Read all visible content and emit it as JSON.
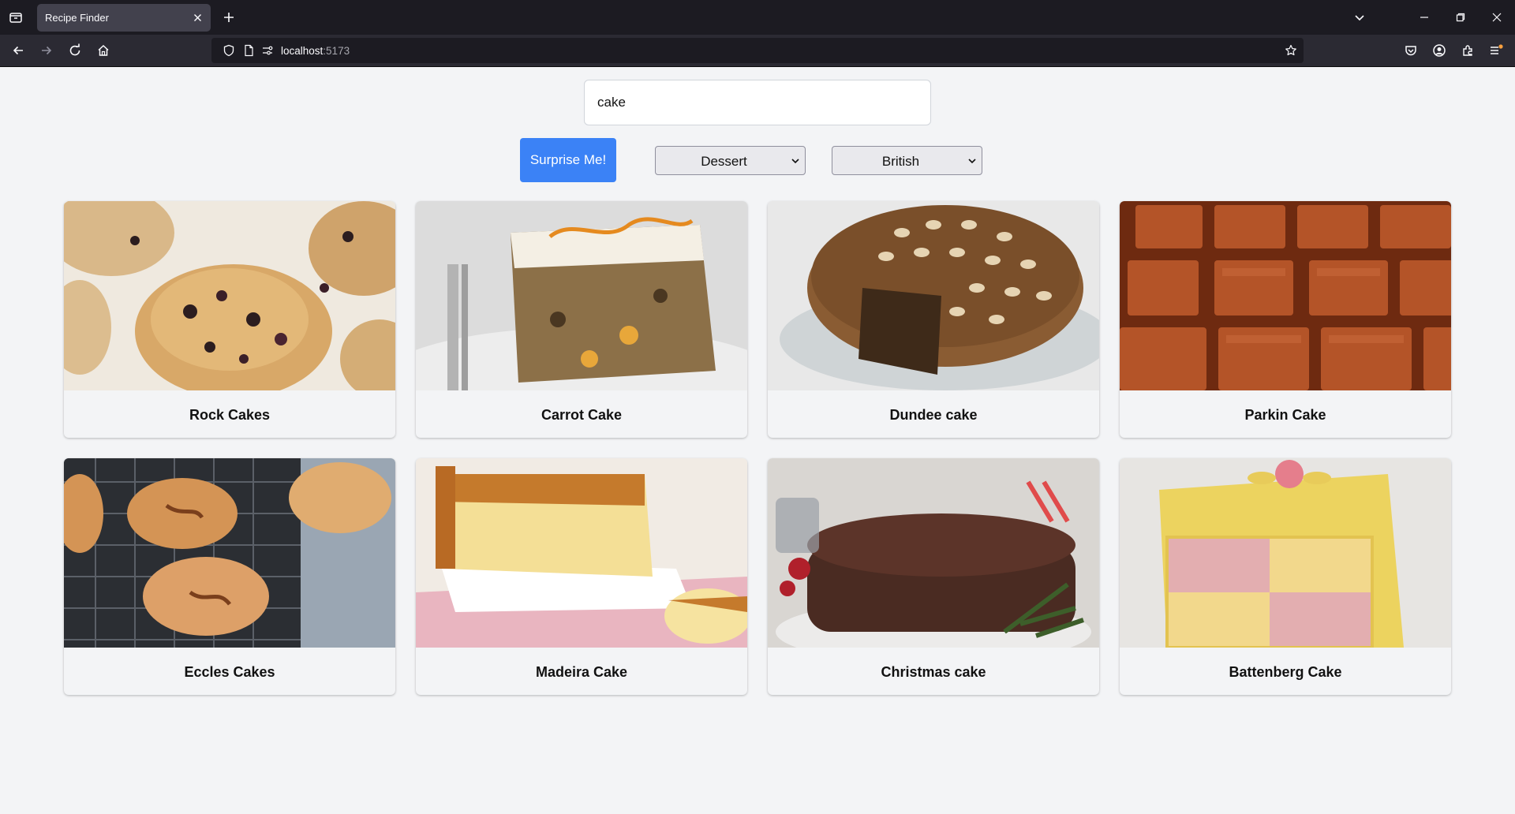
{
  "browser": {
    "tab_title": "Recipe Finder",
    "url_host": "localhost",
    "url_port": ":5173"
  },
  "search": {
    "value": "cake"
  },
  "controls": {
    "surprise_label": "Surprise Me!",
    "category_selected": "Dessert",
    "area_selected": "British"
  },
  "recipes": [
    {
      "title": "Rock Cakes",
      "image": "rock-cakes-photo"
    },
    {
      "title": "Carrot Cake",
      "image": "carrot-cake-photo"
    },
    {
      "title": "Dundee cake",
      "image": "dundee-cake-photo"
    },
    {
      "title": "Parkin Cake",
      "image": "parkin-cake-photo"
    },
    {
      "title": "Eccles Cakes",
      "image": "eccles-cakes-photo"
    },
    {
      "title": "Madeira Cake",
      "image": "madeira-cake-photo"
    },
    {
      "title": "Christmas cake",
      "image": "christmas-cake-photo"
    },
    {
      "title": "Battenberg Cake",
      "image": "battenberg-cake-photo"
    }
  ],
  "colors": {
    "accent": "#3b82f6",
    "page_bg": "#f3f4f6",
    "chrome_dark": "#1c1b22",
    "chrome_toolbar": "#2b2a33"
  }
}
